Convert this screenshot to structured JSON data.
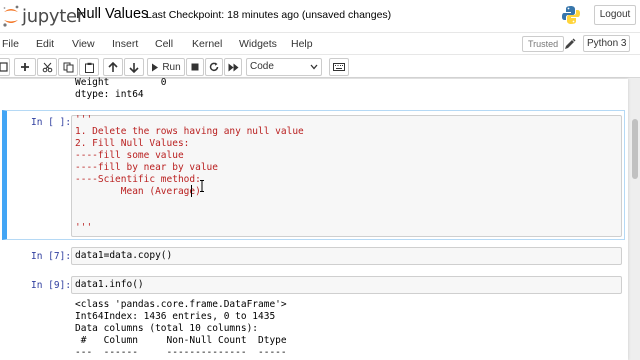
{
  "header": {
    "logo_text": "jupyter",
    "notebook_title": "Null Values",
    "checkpoint_label": "Last Checkpoint:",
    "checkpoint_time": "18 minutes ago",
    "save_status": "(unsaved changes)",
    "logout_label": "Logout"
  },
  "menubar": {
    "items": [
      "File",
      "Edit",
      "View",
      "Insert",
      "Cell",
      "Kernel",
      "Widgets",
      "Help"
    ],
    "trusted_label": "Trusted",
    "kernel_name": "Python 3"
  },
  "toolbar": {
    "run_label": "Run",
    "cell_type": "Code"
  },
  "cells": {
    "prev_output": {
      "lines": [
        "Weight         0",
        "dtype: int64"
      ]
    },
    "cell1": {
      "prompt": "In [ ]:",
      "code_lines": [
        "'''",
        "1. Delete the rows having any null value",
        "2. Fill Null Values:",
        "----fill some value",
        "----fill by near by value",
        "----Scientific method:",
        "        Mean (Average)",
        "",
        "",
        "'''"
      ]
    },
    "cell2": {
      "prompt": "In [7]:",
      "code": "data1=data.copy()"
    },
    "cell3": {
      "prompt": "In [9]:",
      "code": "data1.info()",
      "output_lines": [
        "<class 'pandas.core.frame.DataFrame'>",
        "Int64Index: 1436 entries, 0 to 1435",
        "Data columns (total 10 columns):",
        " #   Column     Non-Null Count  Dtype",
        "---  ------     --------------  -----"
      ]
    }
  },
  "colors": {
    "selected_bar": "#42a5f5",
    "prompt_blue": "#303f9f",
    "string_red": "#ba2121",
    "jupyter_orange": "#f37626"
  }
}
